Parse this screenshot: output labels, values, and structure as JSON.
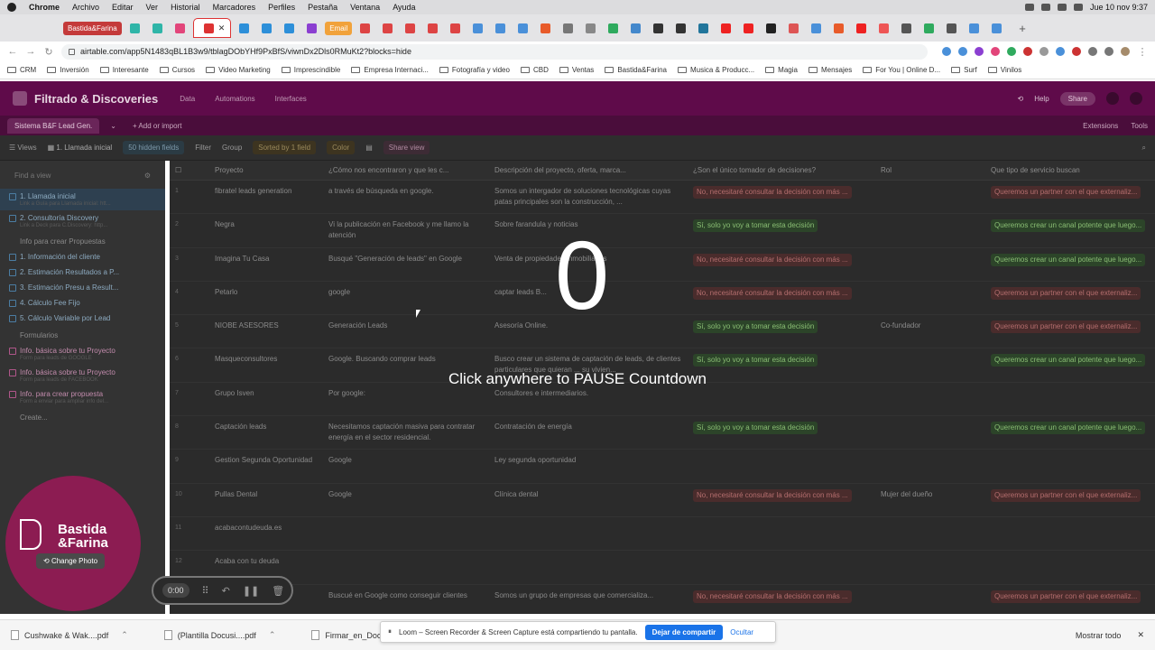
{
  "macos": {
    "app": "Chrome",
    "menus": [
      "Archivo",
      "Editar",
      "Ver",
      "Historial",
      "Marcadores",
      "Perfiles",
      "Pestaña",
      "Ventana",
      "Ayuda"
    ],
    "datetime": "Jue 10 nov  9:37"
  },
  "browser": {
    "tabs": [
      {
        "label": "Bastida&Farina",
        "color": "#c43a3a"
      },
      {
        "label": "Email",
        "color": "#f1a23b"
      }
    ],
    "url": "airtable.com/app5N1483qBL1B3w9/tblagDObYHf9PxBfS/viwnDx2Dls0RMuKt2?blocks=hide",
    "bookmarks": [
      "CRM",
      "Inversión",
      "Interesante",
      "Cursos",
      "Video Marketing",
      "Imprescindible",
      "Empresa Internaci...",
      "Fotografía y video",
      "CBD",
      "Ventas",
      "Bastida&Farina",
      "Musica & Producc...",
      "Magia",
      "Mensajes",
      "For You | Online D...",
      "Surf",
      "Vinilos"
    ]
  },
  "airtable": {
    "base_title": "Filtrado & Discoveries",
    "nav": [
      "Data",
      "Automations",
      "Interfaces"
    ],
    "help": "Help",
    "share": "Share",
    "table_tab": "Sistema B&F Lead Gen.",
    "add_import": "+ Add or import",
    "extensions": "Extensions",
    "tools": "Tools",
    "toolbar": {
      "views": "Views",
      "view_name": "1. Llamada inicial",
      "hidden": "50 hidden fields",
      "filter": "Filter",
      "group": "Group",
      "sorted": "Sorted by 1 field",
      "color": "Color",
      "share_view": "Share view"
    },
    "sidebar": {
      "find": "Find a view",
      "views": [
        {
          "name": "1. Llamada inicial",
          "sub": "Link a Guía para Llamada inicial: htt...",
          "active": true
        },
        {
          "name": "2. Consultoría Discovery",
          "sub": "Link a Deck para C.Discovery: http..."
        }
      ],
      "section_propuestas": "Info para crear Propuestas",
      "propuestas": [
        "1. Información del cliente",
        "2. Estimación Resultados a P...",
        "3. Estimación Presu a Result...",
        "4. Cálculo Fee Fijo",
        "5. Cálculo Variable por Lead"
      ],
      "section_forms": "Formularios",
      "forms": [
        {
          "name": "Info. básica sobre tu Proyecto",
          "sub": "Form para leads de GOOGLE"
        },
        {
          "name": "Info. básica sobre tu Proyecto",
          "sub": "Form para leads de FACEBOOK"
        },
        {
          "name": "Info. para crear propuesta",
          "sub": "Form a enviar para ampliar info del..."
        }
      ],
      "create": "Create..."
    },
    "columns": [
      "Proyecto",
      "¿Cómo nos encontraron y que les c...",
      "Descripción del proyecto, oferta, marca...",
      "¿Son el único tomador de decisiones?",
      "Rol",
      "Que tipo de servicio buscan"
    ],
    "rows": [
      {
        "n": "1",
        "proyecto": "fibratel leads generation",
        "como": "a través de búsqueda en google.",
        "desc": "Somos un intergador de soluciones tecnológicas cuyas patas principales son la construcción, ...",
        "tom": "No, necesitaré consultar la decisión con más ...",
        "tom_c": "red",
        "rol": "",
        "serv": "Queremos un partner con el que externaliz...",
        "serv_c": "red"
      },
      {
        "n": "2",
        "proyecto": "Negra",
        "como": "Vi la publicación en Facebook y me llamo la atención",
        "desc": "Sobre farandula y noticias",
        "tom": "Sí, solo yo voy a tomar esta decisión",
        "tom_c": "green",
        "rol": "",
        "serv": "Queremos crear un canal potente que luego...",
        "serv_c": "green"
      },
      {
        "n": "3",
        "proyecto": "Imagina Tu Casa",
        "como": "Busqué \"Generación de leads\" en Google",
        "desc": "Venta de propiedades inmobiliarias",
        "tom": "No, necesitaré consultar la decisión con más ...",
        "tom_c": "red",
        "rol": "",
        "serv": "Queremos crear un canal potente que luego...",
        "serv_c": "green"
      },
      {
        "n": "4",
        "proyecto": "Petarlo",
        "como": "google",
        "desc": "captar leads B...",
        "tom": "No, necesitaré consultar la decisión con más ...",
        "tom_c": "red",
        "rol": "",
        "serv": "Queremos un partner con el que externaliz...",
        "serv_c": "red"
      },
      {
        "n": "5",
        "proyecto": "NIOBE ASESORES",
        "como": "Generación Leads",
        "desc": "Asesoría Online.",
        "tom": "Sí, solo yo voy a tomar esta decisión",
        "tom_c": "green",
        "rol": "Co-fundador",
        "serv": "Queremos un partner con el que externaliz...",
        "serv_c": "red"
      },
      {
        "n": "6",
        "proyecto": "Masqueconsultores",
        "como": "Google. Buscando comprar leads",
        "desc": "Busco crear un sistema de captación de leads, de clientes particulares que quieran ... su vivien...",
        "tom": "Sí, solo yo voy a tomar esta decisión",
        "tom_c": "green",
        "rol": "",
        "serv": "Queremos crear un canal potente que luego...",
        "serv_c": "green"
      },
      {
        "n": "7",
        "proyecto": "Grupo Isven",
        "como": "Por google:",
        "desc": "Consultores e intermediarios.",
        "tom": "",
        "tom_c": "",
        "rol": "",
        "serv": "",
        "serv_c": ""
      },
      {
        "n": "8",
        "proyecto": "Captación leads",
        "como": "Necesitamos captación masiva para contratar energía en el sector residencial.",
        "desc": "Contratación de energía",
        "tom": "Sí, solo yo voy a tomar esta decisión",
        "tom_c": "green",
        "rol": "",
        "serv": "Queremos crear un canal potente que luego...",
        "serv_c": "green"
      },
      {
        "n": "9",
        "proyecto": "Gestion Segunda Oportunidad",
        "como": "Google",
        "desc": "Ley segunda oportunidad",
        "tom": "",
        "tom_c": "",
        "rol": "",
        "serv": "",
        "serv_c": ""
      },
      {
        "n": "10",
        "proyecto": "Pullas Dental",
        "como": "Google",
        "desc": "Clínica dental",
        "tom": "No, necesitaré consultar la decisión con más ...",
        "tom_c": "red",
        "rol": "Mujer del dueño",
        "serv": "Queremos un partner con el que externaliz...",
        "serv_c": "red"
      },
      {
        "n": "11",
        "proyecto": "acabacontudeuda.es",
        "como": "",
        "desc": "",
        "tom": "",
        "tom_c": "",
        "rol": "",
        "serv": "",
        "serv_c": ""
      },
      {
        "n": "12",
        "proyecto": "Acaba con tu deuda",
        "como": "",
        "desc": "",
        "tom": "",
        "tom_c": "",
        "rol": "",
        "serv": "",
        "serv_c": ""
      },
      {
        "n": "",
        "proyecto": "",
        "como": "Buscué en Google como conseguir clientes",
        "desc": "Somos un grupo de empresas que comercializa...",
        "tom": "No, necesitaré consultar la decisión con más ...",
        "tom_c": "red",
        "rol": "",
        "serv": "Queremos un partner con el que externaliz...",
        "serv_c": "red"
      }
    ]
  },
  "overlay": {
    "countdown": "0",
    "message": "Click anywhere to PAUSE Countdown"
  },
  "loom": {
    "brand_line1": "Bastida",
    "brand_line2": "&Farina",
    "change_photo": "Change Photo",
    "timer": "0:00",
    "share_notice": "Loom – Screen Recorder & Screen Capture está compartiendo tu pantalla.",
    "stop_label": "Dejar de compartir",
    "hide_label": "Ocultar"
  },
  "downloads": {
    "files": [
      "Cushwake & Wak....pdf",
      "(Plantilla Docusi....pdf",
      "Firmar_en_Docu...."
    ],
    "show_all": "Mostrar todo"
  }
}
